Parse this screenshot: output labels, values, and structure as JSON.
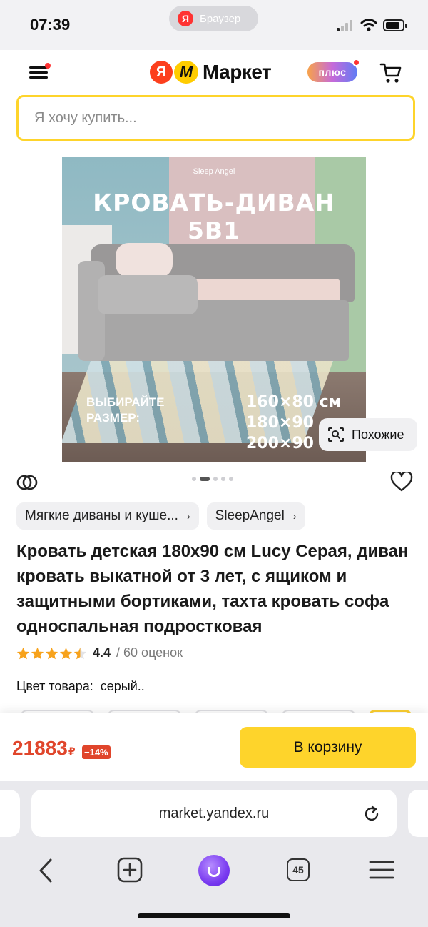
{
  "status_bar": {
    "time": "07:39",
    "browser_label": "Браузер",
    "browser_badge": "Я"
  },
  "header": {
    "logo_ya": "Я",
    "logo_m": "М",
    "logo_text": "Маркет",
    "plus_label": "плюс",
    "search": {
      "placeholder": "Я хочу купить...",
      "value": ""
    }
  },
  "gallery": {
    "image_brand": "Sleep Angel",
    "image_title": "КРОВАТЬ-ДИВАН 5В1",
    "image_size_label": "ВЫБИРАЙТЕ РАЗМЕР:",
    "image_sizes": [
      "160×80 см",
      "180×90",
      "200×90"
    ],
    "similar_label": "Похожие",
    "dots_total": 5,
    "dots_active_index": 1
  },
  "product": {
    "breadcrumbs": [
      {
        "label": "Мягкие диваны и куше..."
      },
      {
        "label": "SleepAngel"
      }
    ],
    "title": "Кровать детская 180х90 см Lucy Серая, диван кровать выкатной от 3 лет, с ящиком и защитными бортиками, тахта кровать софа односпальная подростковая",
    "rating_value": "4.4",
    "rating_stars": 4.5,
    "rating_count": "/ 60 оценок",
    "color_label": "Цвет товара:",
    "color_value": "серый.."
  },
  "buy": {
    "price": "21883",
    "currency": "₽",
    "discount": "−14%",
    "cart_label": "В корзину"
  },
  "browser": {
    "url": "market.yandex.ru",
    "tabs_count": "45"
  },
  "colors": {
    "accent_yellow": "#fed42b",
    "price_red": "#e0452b",
    "star_orange": "#f7a21b"
  }
}
